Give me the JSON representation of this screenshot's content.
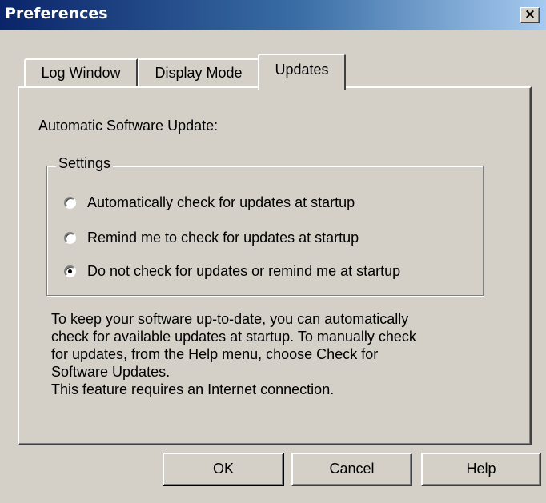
{
  "window": {
    "title": "Preferences",
    "close_label": "×"
  },
  "tabs": [
    {
      "label": "Log Window",
      "active": false
    },
    {
      "label": "Display Mode",
      "active": false
    },
    {
      "label": "Updates",
      "active": true
    }
  ],
  "panel": {
    "heading": "Automatic Software Update:",
    "settings": {
      "legend": "Settings",
      "options": [
        {
          "label": "Automatically check for updates at startup",
          "checked": false
        },
        {
          "label": "Remind me to check for updates at startup",
          "checked": false
        },
        {
          "label": "Do not check for updates or remind me at startup",
          "checked": true
        }
      ]
    },
    "info_lines": [
      "To keep your software up-to-date, you can automatically",
      "check for available updates at startup.  To manually check",
      "for updates, from the Help menu, choose Check for",
      "Software Updates.",
      "This feature requires an Internet connection."
    ]
  },
  "buttons": {
    "ok": "OK",
    "cancel": "Cancel",
    "help": "Help"
  }
}
